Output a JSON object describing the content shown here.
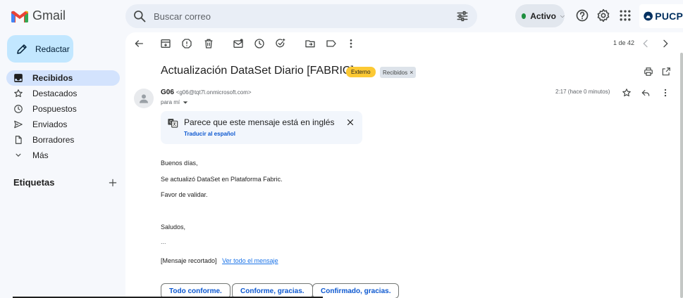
{
  "app": {
    "name": "Gmail"
  },
  "search": {
    "placeholder": "Buscar correo"
  },
  "status": {
    "label": "Activo",
    "color": "#1e8e3e"
  },
  "org": {
    "name": "PUCP"
  },
  "compose": {
    "label": "Redactar"
  },
  "sidebar": {
    "items": [
      {
        "label": "Recibidos",
        "icon": "inbox-icon",
        "active": true
      },
      {
        "label": "Destacados",
        "icon": "star-icon",
        "active": false
      },
      {
        "label": "Pospuestos",
        "icon": "clock-icon",
        "active": false
      },
      {
        "label": "Enviados",
        "icon": "send-icon",
        "active": false
      },
      {
        "label": "Borradores",
        "icon": "draft-icon",
        "active": false
      },
      {
        "label": "Más",
        "icon": "chevron-down-icon",
        "active": false
      }
    ],
    "labels_heading": "Etiquetas"
  },
  "toolbar": {
    "pager": "1 de 42"
  },
  "message": {
    "subject": "Actualización DataSet Diario [FABRIC]",
    "badge_external": "Externo",
    "badge_inbox": "Recibidos",
    "sender_name": "G06",
    "sender_email": "<g06@tqt7l.onmicrosoft.com>",
    "to": "para mí",
    "time": "2:17 (hace 0 minutos)",
    "translate_title": "Parece que este mensaje está en inglés",
    "translate_link": "Traducir al español",
    "body": {
      "greeting": "Buenos días,",
      "line1": "Se actualizó DataSet en Plataforma Fabric.",
      "line2": "Favor de validar.",
      "closing": "Saludos,",
      "ellipsis": "...",
      "clipped": "[Mensaje recortado]",
      "view_all": "Ver todo el mensaje"
    }
  },
  "smart_replies": [
    "Todo conforme.",
    "Conforme, gracias.",
    "Confirmado, gracias."
  ]
}
